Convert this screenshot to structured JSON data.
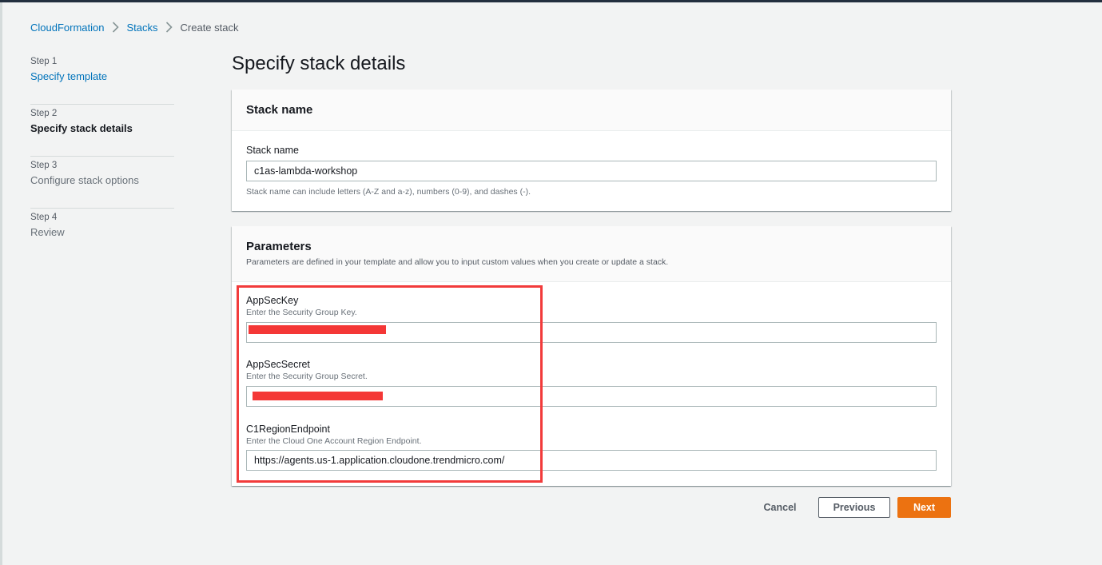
{
  "breadcrumb": {
    "items": [
      "CloudFormation",
      "Stacks",
      "Create stack"
    ]
  },
  "steps": [
    {
      "number": "Step 1",
      "label": "Specify template",
      "state": "link"
    },
    {
      "number": "Step 2",
      "label": "Specify stack details",
      "state": "current"
    },
    {
      "number": "Step 3",
      "label": "Configure stack options",
      "state": "disabled"
    },
    {
      "number": "Step 4",
      "label": "Review",
      "state": "disabled"
    }
  ],
  "page_title": "Specify stack details",
  "stack_name_panel": {
    "title": "Stack name",
    "field_label": "Stack name",
    "value": "c1as-lambda-workshop",
    "hint": "Stack name can include letters (A-Z and a-z), numbers (0-9), and dashes (-)."
  },
  "parameters_panel": {
    "title": "Parameters",
    "description": "Parameters are defined in your template and allow you to input custom values when you create or update a stack.",
    "params": [
      {
        "label": "AppSecKey",
        "description": "Enter the Security Group Key.",
        "value": ""
      },
      {
        "label": "AppSecSecret",
        "description": "Enter the Security Group Secret.",
        "value": ""
      },
      {
        "label": "C1RegionEndpoint",
        "description": "Enter the Cloud One Account Region Endpoint.",
        "value": "https://agents.us-1.application.cloudone.trendmicro.com/"
      }
    ]
  },
  "actions": {
    "cancel": "Cancel",
    "previous": "Previous",
    "next": "Next"
  },
  "colors": {
    "link": "#0073bb",
    "primary_button": "#ec7211",
    "highlight_box": "#f23b3b",
    "redaction": "#f43736"
  },
  "icons": {
    "breadcrumb_separator": "chevron-right-icon"
  }
}
